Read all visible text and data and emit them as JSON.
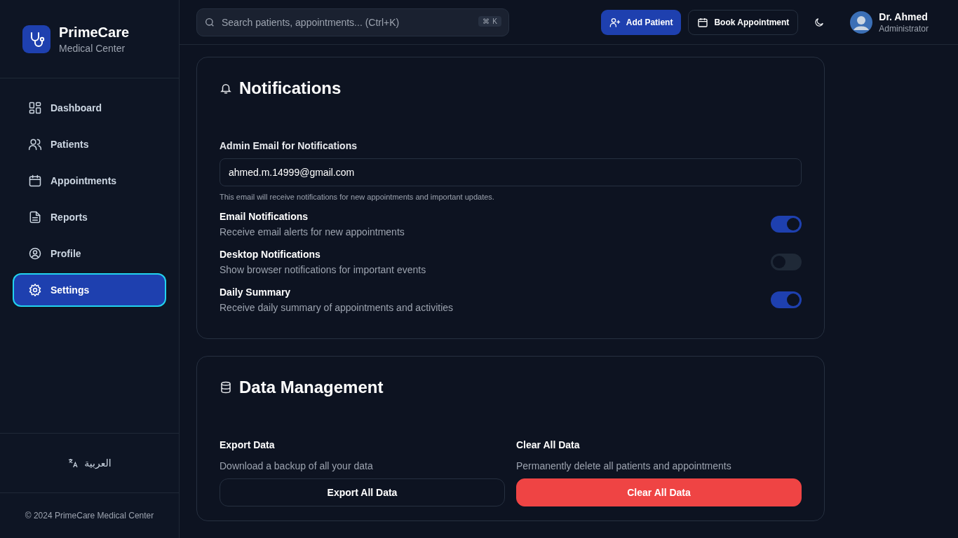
{
  "brand": {
    "name": "PrimeCare",
    "subtitle": "Medical Center"
  },
  "nav": [
    {
      "label": "Dashboard",
      "selected": false
    },
    {
      "label": "Patients",
      "selected": false
    },
    {
      "label": "Appointments",
      "selected": false
    },
    {
      "label": "Reports",
      "selected": false
    },
    {
      "label": "Profile",
      "selected": false
    },
    {
      "label": "Settings",
      "selected": true
    }
  ],
  "language": "العربية",
  "copyright": "© 2024 PrimeCare Medical Center",
  "search": {
    "placeholder": "Search patients, appointments... (Ctrl+K)",
    "shortcut": [
      "⌘",
      "K"
    ]
  },
  "header_buttons": {
    "add": "Add Patient",
    "book": "Book Appointment"
  },
  "user": {
    "name": "Dr. Ahmed",
    "role": "Administrator"
  },
  "notifications": {
    "title": "Notifications",
    "email_label": "Admin Email for Notifications",
    "email_value": "ahmed.m.14999@gmail.com",
    "email_hint": "This email will receive notifications for new appointments and important updates.",
    "toggles": [
      {
        "title": "Email Notifications",
        "description": "Receive email alerts for new appointments",
        "on": true
      },
      {
        "title": "Desktop Notifications",
        "description": "Show browser notifications for important events",
        "on": false
      },
      {
        "title": "Daily Summary",
        "description": "Receive daily summary of appointments and activities",
        "on": true
      }
    ]
  },
  "data_management": {
    "title": "Data Management",
    "actions": [
      {
        "kind": "export",
        "title": "Export Data",
        "description": "Download a backup of all your data",
        "button": "Export All Data"
      },
      {
        "kind": "danger",
        "title": "Clear All Data",
        "description": "Permanently delete all patients and appointments",
        "button": "Clear All Data"
      }
    ]
  }
}
